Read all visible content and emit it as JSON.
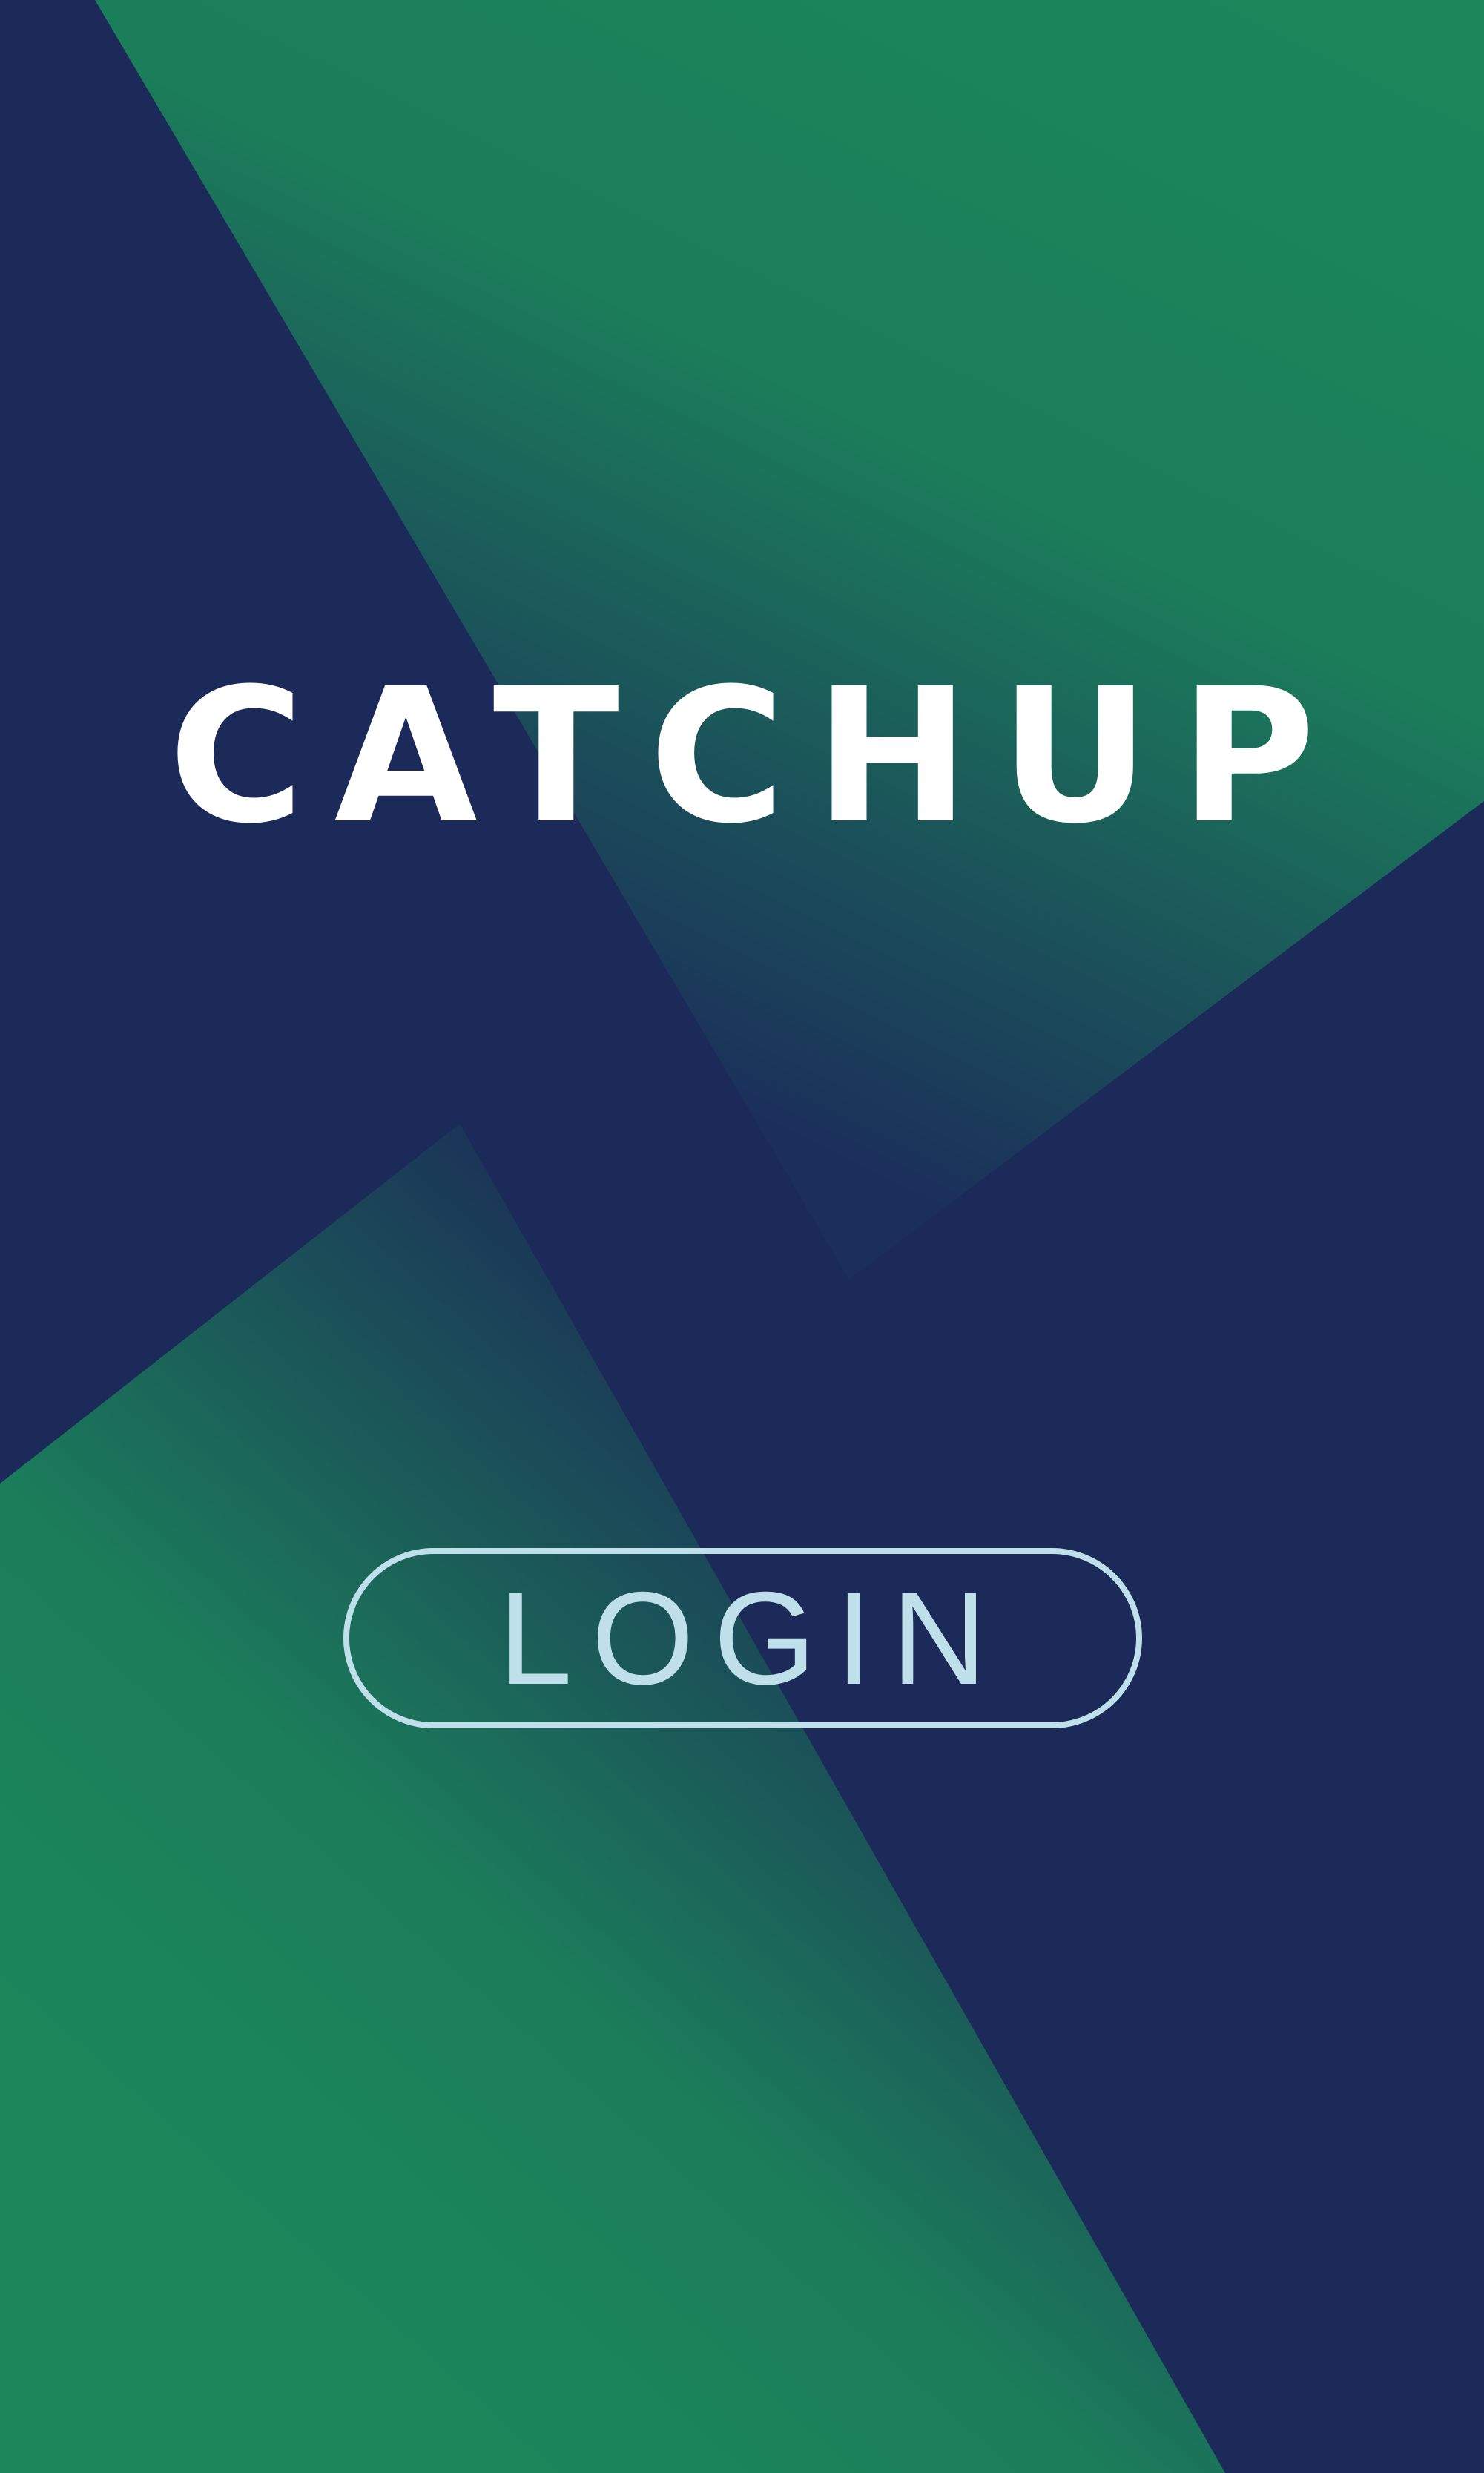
{
  "app": {
    "logo_text": "CATCHUP"
  },
  "login": {
    "label": "LOGIN"
  },
  "colors": {
    "navy_background": "#1b2a59",
    "brand_green": "#1b875b",
    "logo_text": "#ffffff",
    "login_outline": "#bfe0ea"
  }
}
